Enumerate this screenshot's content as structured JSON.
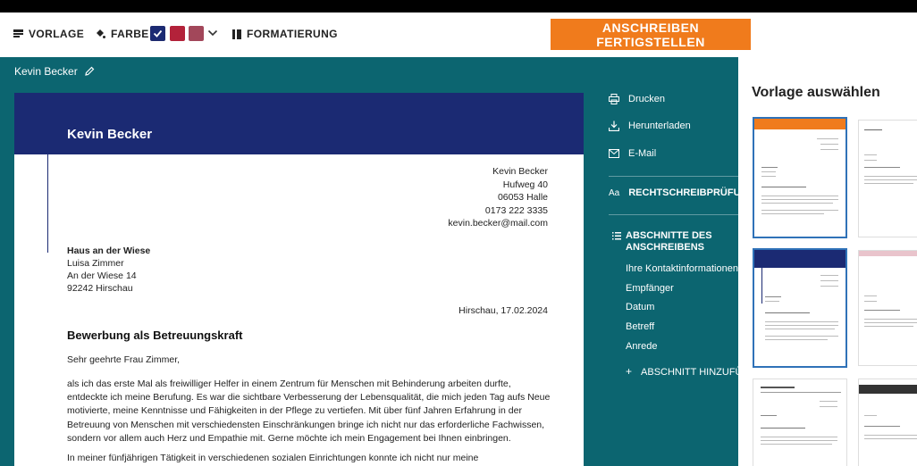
{
  "toolbar": {
    "vorlage_label": "VORLAGE",
    "farbe_label": "FARBE",
    "formatierung_label": "FORMATIERUNG",
    "finish_label": "ANSCHREIBEN FERTIGSTELLEN",
    "colors": [
      "#1b2a73",
      "#b3223a",
      "#a2475a"
    ],
    "accent": "#f07b1c"
  },
  "document": {
    "name": "Kevin Becker"
  },
  "letter": {
    "header_name": "Kevin Becker",
    "sender": {
      "name": "Kevin Becker",
      "street": "Hufweg 40",
      "city": "06053 Halle",
      "phone": "0173 222 3335",
      "email": "kevin.becker@mail.com"
    },
    "recipient": {
      "company": "Haus an der Wiese",
      "contact": "Luisa Zimmer",
      "street": "An der Wiese 14",
      "city": "92242 Hirschau"
    },
    "date": "Hirschau, 17.02.2024",
    "subject": "Bewerbung als Betreuungskraft",
    "salutation": "Sehr geehrte Frau Zimmer,",
    "paragraph1": "als ich das erste Mal als freiwilliger Helfer in einem Zentrum für Menschen mit Behinderung arbeiten durfte, entdeckte ich meine Berufung. Es war die sichtbare Verbesserung der Lebensqualität, die mich jeden Tag aufs Neue motivierte, meine Kenntnisse und Fähigkeiten in der Pflege zu vertiefen. Mit über fünf Jahren Erfahrung in der Betreuung von Menschen mit verschiedensten Einschränkungen bringe ich nicht nur das erforderliche Fachwissen, sondern vor allem auch Herz und Empathie mit. Gerne möchte ich mein Engagement bei Ihnen einbringen.",
    "paragraph2": "In meiner fünfjährigen Tätigkeit in verschiedenen sozialen Einrichtungen konnte ich nicht nur meine"
  },
  "actions": {
    "print": "Drucken",
    "download": "Herunterladen",
    "email": "E-Mail",
    "spellcheck": "RECHTSCHREIBPRÜFUNG",
    "spellcheck_icon_text": "Aa",
    "sections_title_line1": "ABSCHNITTE DES",
    "sections_title_line2": "ANSCHREIBENS",
    "sections": [
      "Ihre Kontaktinformationen",
      "Empfänger",
      "Datum",
      "Betreff",
      "Anrede"
    ],
    "add_section": "ABSCHNITT HINZUFÜGEN"
  },
  "template_panel": {
    "title": "Vorlage auswählen"
  }
}
